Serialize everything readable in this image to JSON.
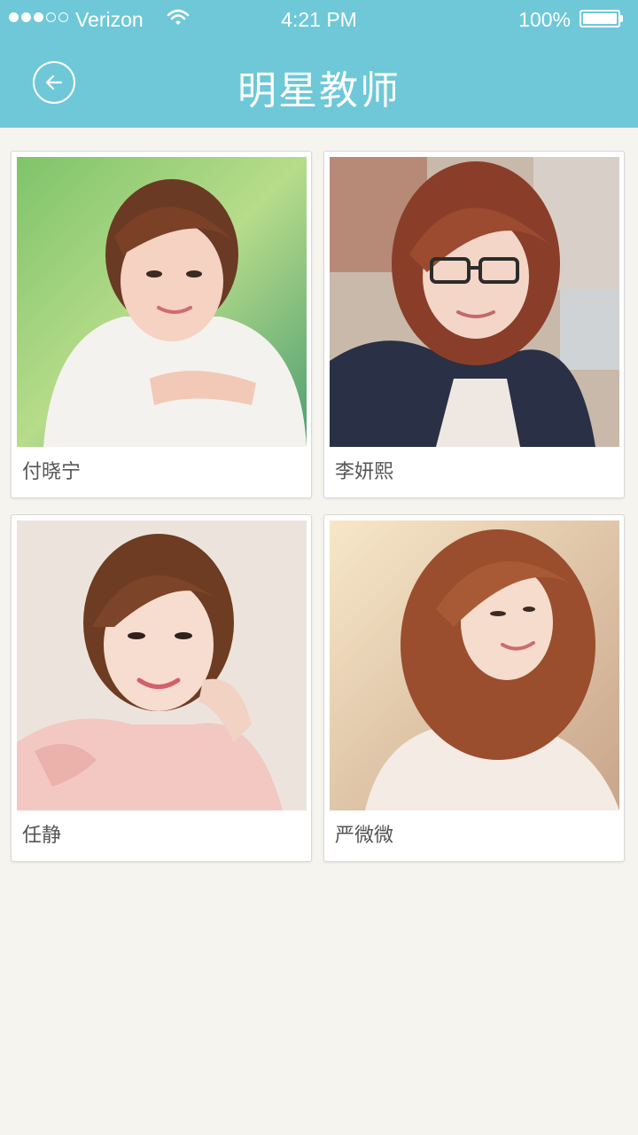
{
  "status_bar": {
    "carrier": "Verizon",
    "time": "4:21 PM",
    "battery": "100%",
    "signal_dots_filled": 3,
    "signal_dots_total": 5
  },
  "header": {
    "title": "明星教师",
    "back_icon": "back-arrow-icon",
    "background_color": "#6ec8d8"
  },
  "teachers": [
    {
      "name": "付晓宁"
    },
    {
      "name": "李妍熙"
    },
    {
      "name": "任静"
    },
    {
      "name": "严微微"
    }
  ]
}
